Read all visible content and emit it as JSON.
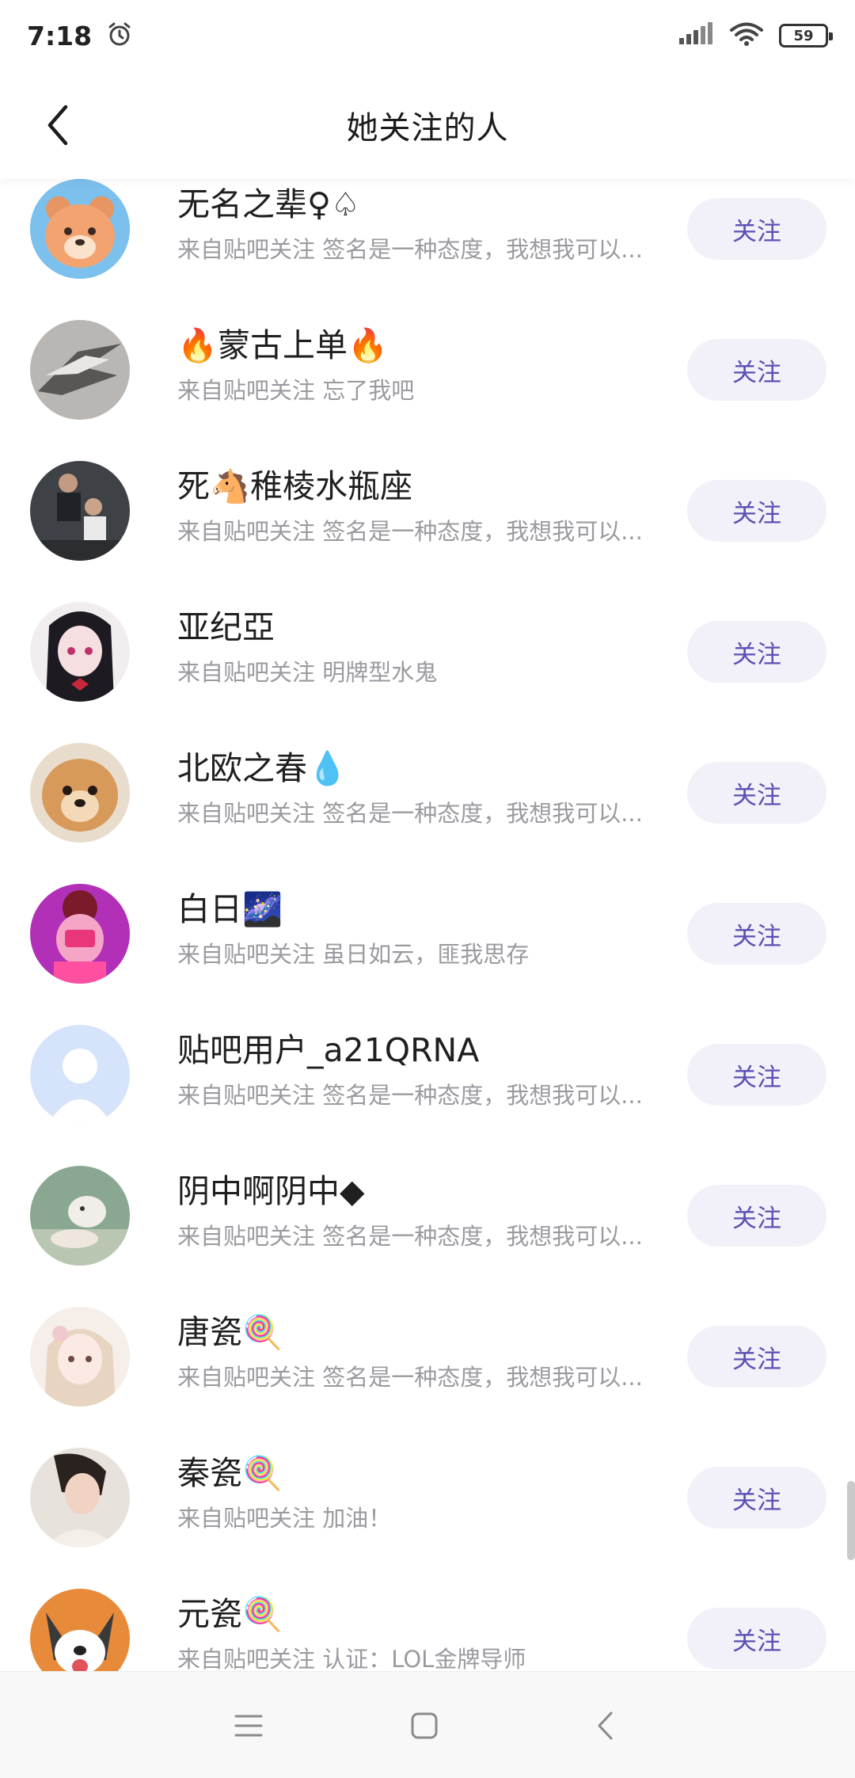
{
  "status": {
    "time": "7:18",
    "battery": "59"
  },
  "header": {
    "title": "她关注的人"
  },
  "users": [
    {
      "name": "无名之辈♀♤",
      "desc": "来自贴吧关注 签名是一种态度，我想我可以...",
      "follow": "关注"
    },
    {
      "name": "🔥蒙古上单🔥",
      "desc": "来自贴吧关注 忘了我吧",
      "follow": "关注"
    },
    {
      "name": "死🐴稚棱水瓶座",
      "desc": "来自贴吧关注 签名是一种态度，我想我可以...",
      "follow": "关注"
    },
    {
      "name": "亚纪亞",
      "desc": "来自贴吧关注 明牌型水鬼",
      "follow": "关注"
    },
    {
      "name": "北欧之春💧",
      "desc": "来自贴吧关注 签名是一种态度，我想我可以...",
      "follow": "关注"
    },
    {
      "name": "白日🌌",
      "desc": "来自贴吧关注 虽日如云，匪我思存",
      "follow": "关注"
    },
    {
      "name": "贴吧用户_a21QRNA",
      "desc": "来自贴吧关注 签名是一种态度，我想我可以...",
      "follow": "关注"
    },
    {
      "name": "阴中啊阴中◆",
      "desc": "来自贴吧关注 签名是一种态度，我想我可以...",
      "follow": "关注"
    },
    {
      "name": "唐瓷🍭",
      "desc": "来自贴吧关注 签名是一种态度，我想我可以...",
      "follow": "关注"
    },
    {
      "name": "秦瓷🍭",
      "desc": "来自贴吧关注 加油！",
      "follow": "关注"
    },
    {
      "name": "元瓷🍭",
      "desc": "来自贴吧关注 认证：LOL金牌导师",
      "follow": "关注"
    }
  ],
  "icons": {
    "back": "chevron-left-icon",
    "alarm": "alarm-icon",
    "signal": "signal-icon",
    "wifi": "wifi-icon",
    "nav_menu": "menu-icon",
    "nav_home": "home-square-icon",
    "nav_back": "back-arrow-icon"
  },
  "colors": {
    "accent": "#5b4fb3",
    "button_bg": "#f2f0f9"
  }
}
